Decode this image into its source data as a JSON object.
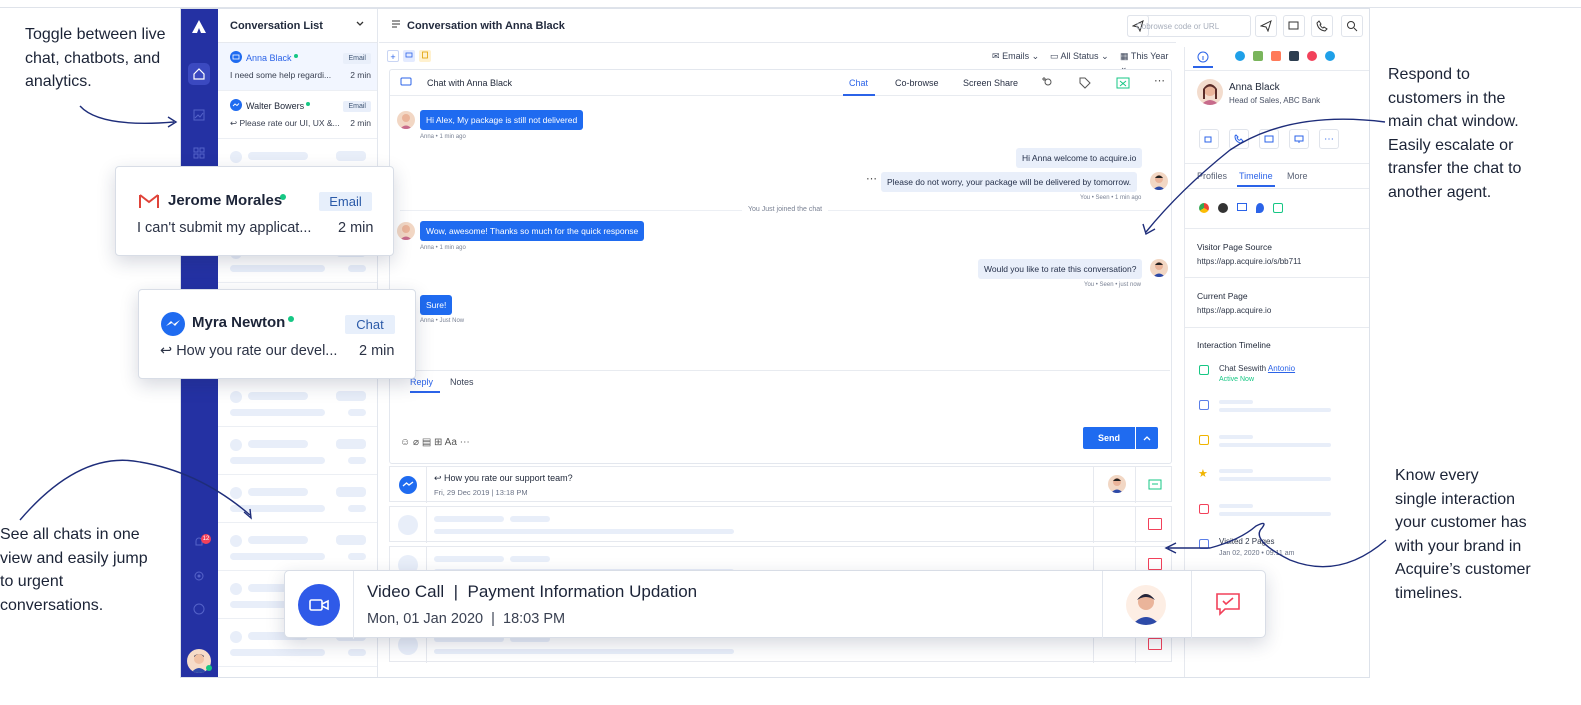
{
  "annotations": {
    "toggle": [
      "Toggle between live",
      "chat, chatbots, and",
      "analytics."
    ],
    "see_all": [
      "See all chats in one",
      "view and easily jump",
      "to urgent",
      "conversations."
    ],
    "respond": [
      "Respond to",
      "customers in the",
      "main chat window.",
      "Easily escalate or",
      "transfer the chat to",
      "another agent."
    ],
    "know": [
      "Know every",
      "single interaction",
      "your customer has",
      "with your brand in",
      "Acquire’s customer",
      "timelines."
    ]
  },
  "rail": {
    "badge": "12"
  },
  "conversation_list": {
    "title": "Conversation List",
    "items": [
      {
        "name": "Anna Black",
        "tag": "Email",
        "message": "I need some help regardi...",
        "time": "2 min"
      },
      {
        "name": "Walter Bowers",
        "tag": "Email",
        "message": "Please rate our UI, UX &...",
        "time": "2 min"
      }
    ]
  },
  "header": {
    "title": "Conversation with Anna Black",
    "cobrowse_placeholder": "Cobrowse code or URL"
  },
  "filters": {
    "emails": "Emails",
    "status": "All Status",
    "period": "This Year"
  },
  "chat": {
    "title": "Chat with Anna Black",
    "tabs": [
      "Chat",
      "Co-browse",
      "Screen Share"
    ],
    "messages": {
      "m1": "Hi Alex, My package is still not delivered",
      "m1_meta": "Anna • 1 min ago",
      "m2": "Hi Anna welcome to acquire.io",
      "m3": "Please do not worry, your package will be delivered by tomorrow.",
      "m3_meta": "You • Seen • 1 min ago",
      "joined": "You Just joined the chat",
      "m4": "Wow, awesome! Thanks so much for the quick response",
      "m4_meta": "Anna • 1 min ago",
      "m5": "Would you like to rate this conversation?",
      "m5_meta": "You • Seen • just now",
      "m6": "Sure!",
      "m6_meta": "Anna • Just Now"
    },
    "reply_tabs": [
      "Reply",
      "Notes"
    ],
    "send": "Send",
    "format_label": "Aa"
  },
  "timeline_rows": {
    "first_title": "How you rate our support team?",
    "first_date": "Fri, 29 Dec 2019  |  13:18 PM"
  },
  "right_panel": {
    "name": "Anna Black",
    "role": "Head of Sales, ABC Bank",
    "tabs": [
      "Profiles",
      "Timeline",
      "More"
    ],
    "visitor_source_label": "Visitor Page Source",
    "visitor_source_url": "https://app.acquire.io/s/bb711",
    "current_page_label": "Current Page",
    "current_page_url": "https://app.acquire.io",
    "interaction_label": "Interaction Timeline",
    "chat_session_prefix": "Chat Seswith ",
    "chat_session_agent": "Antonio",
    "chat_session_status": "Active Now",
    "visited_pages": "Visited 2 Pages",
    "visited_date": "Jan 02, 2020 • 09:11 am"
  },
  "cards": {
    "jerome": {
      "name": "Jerome Morales",
      "tag": "Email",
      "message": "I can't submit my applicat...",
      "time": "2 min"
    },
    "myra": {
      "name": "Myra Newton",
      "tag": "Chat",
      "message": "How you rate our devel...",
      "time": "2 min"
    },
    "video": {
      "title_a": "Video Call",
      "title_sep": "|",
      "title_b": "Payment Information Updation",
      "date": "Mon, 01 Jan 2020",
      "date_sep": "|",
      "time": "18:03 PM"
    }
  },
  "colors": {
    "rail": "#2431a3",
    "accent": "#1f6bf0",
    "online": "#16c784"
  }
}
